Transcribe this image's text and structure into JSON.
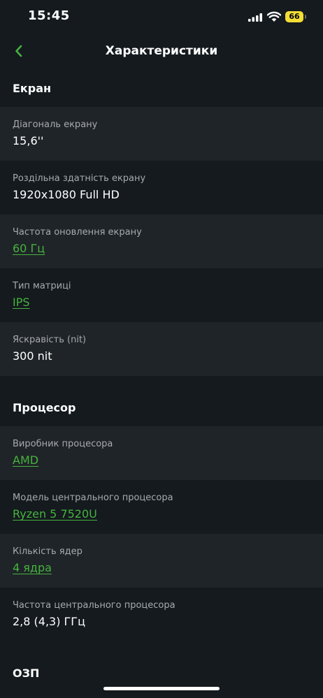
{
  "status_bar": {
    "time": "15:45",
    "battery": "66",
    "icons": [
      "signal-icon",
      "wifi-icon",
      "battery-icon"
    ]
  },
  "header": {
    "back_icon": "chevron-left-icon",
    "title": "Характеристики"
  },
  "colors": {
    "background": "#141a1e",
    "row_alt": "#1f2428",
    "accent": "#46b33e",
    "label": "#a7abaf",
    "battery": "#f2dd36"
  },
  "sections": [
    {
      "title": "Екран",
      "rows": [
        {
          "label": "Діагональ екрану",
          "value": "15,6''",
          "link": false
        },
        {
          "label": "Роздільна здатність екрану",
          "value": "1920x1080 Full HD",
          "link": false
        },
        {
          "label": "Частота оновлення екрану",
          "value": "60 Гц",
          "link": true
        },
        {
          "label": "Тип матриці",
          "value": "IPS",
          "link": true
        },
        {
          "label": "Яскравість (nit)",
          "value": "300 nit",
          "link": false
        }
      ]
    },
    {
      "title": "Процесор",
      "rows": [
        {
          "label": "Виробник процесора",
          "value": "AMD",
          "link": true
        },
        {
          "label": "Модель центрального процесора",
          "value": "Ryzen 5 7520U",
          "link": true
        },
        {
          "label": "Кількість ядер",
          "value": "4 ядра",
          "link": true
        },
        {
          "label": "Частота центрального процесора",
          "value": "2,8 (4,3) ГГц",
          "link": false
        }
      ]
    },
    {
      "title": "ОЗП",
      "rows": []
    }
  ]
}
